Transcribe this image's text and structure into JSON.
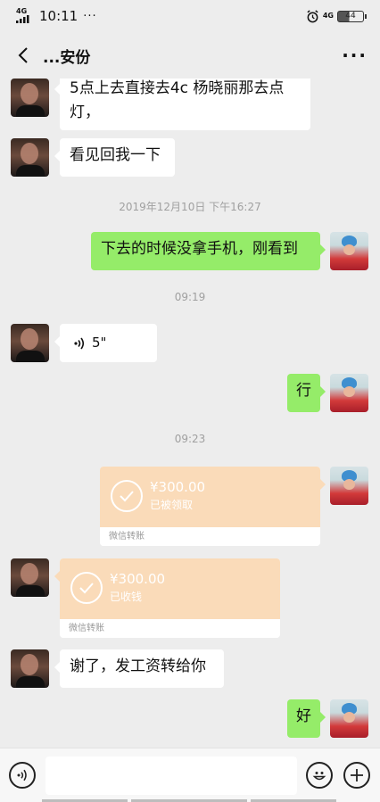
{
  "status_bar": {
    "network": "4G",
    "time": "10:11",
    "dots": "···",
    "net_right": "4G",
    "battery": "44"
  },
  "nav": {
    "title": "...安份",
    "more": "···"
  },
  "messages": {
    "m1": "5点上去直接去4c 杨晓丽那去点灯，",
    "m2": "看见回我一下",
    "t1": "2019年12月10日 下午16:27",
    "m3": "下去的时候没拿手机，刚看到",
    "t2": "09:19",
    "voice_duration": "5\"",
    "m4": "行",
    "t3": "09:23",
    "transfer_out": {
      "amount": "¥300.00",
      "status": "已被领取",
      "footer": "微信转账"
    },
    "transfer_in": {
      "amount": "¥300.00",
      "status": "已收钱",
      "footer": "微信转账"
    },
    "m5": "谢了，发工资转给你",
    "m6": "好"
  },
  "colors": {
    "outgoing": "#95ec69",
    "incoming": "#ffffff",
    "transfer": "#fadbb9",
    "background": "#ededed"
  }
}
